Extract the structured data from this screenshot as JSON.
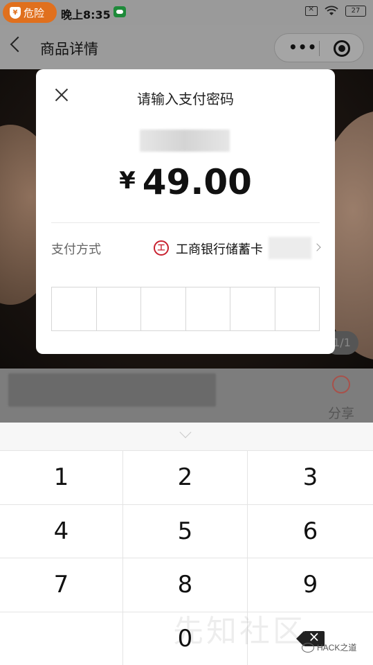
{
  "status_bar": {
    "danger_label": "危险",
    "time": "晚上8:35",
    "battery": "27"
  },
  "nav": {
    "title": "商品详情",
    "more_icon": "more-dots-icon",
    "capsule_icon": "target-circle-icon"
  },
  "product": {
    "page_indicator": "1/1",
    "share_label": "分享"
  },
  "payment_dialog": {
    "title": "请输入支付密码",
    "currency_symbol": "¥",
    "amount": "49.00",
    "method_label": "支付方式",
    "bank_name": "工商银行储蓄卡",
    "password_length": 6
  },
  "keypad": {
    "keys": [
      "1",
      "2",
      "3",
      "4",
      "5",
      "6",
      "7",
      "8",
      "9",
      "",
      "0",
      ""
    ]
  },
  "watermark": {
    "text": "先知社区",
    "brand": "HACK之道"
  },
  "colors": {
    "danger": "#e0701e",
    "bank_red": "#c8202e",
    "overlay": "#7b7b7b"
  }
}
